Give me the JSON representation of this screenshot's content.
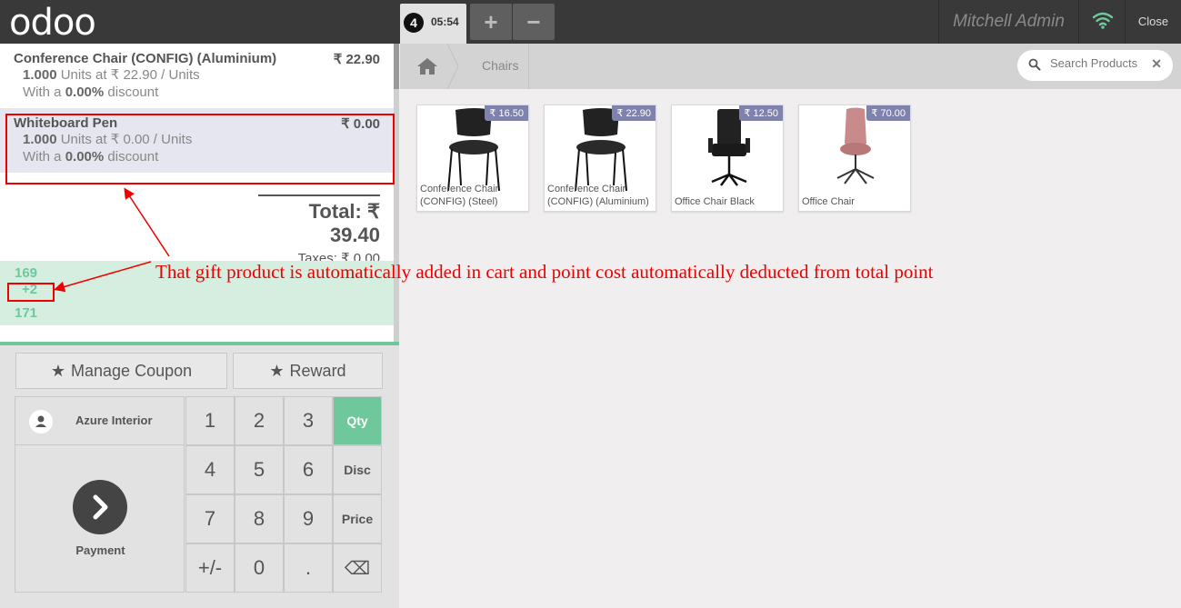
{
  "topbar": {
    "logo": "odoo",
    "order_number": "4",
    "order_time": "05:54",
    "add_order_label": "+",
    "remove_order_label": "−",
    "user_name": "Mitchell Admin",
    "close_label": "Close",
    "wifi_color": "#6ec89b"
  },
  "order": {
    "lines": [
      {
        "name": "Conference Chair (CONFIG) (Aluminium)",
        "price": "₹ 22.90",
        "qty": "1.000",
        "unit_info": "Units at ₹ 22.90 / Units",
        "discount_prefix": "With a",
        "discount": "0.00%",
        "discount_suffix": "discount"
      },
      {
        "name": "Whiteboard Pen",
        "price": "₹ 0.00",
        "qty": "1.000",
        "unit_info": "Units at ₹ 0.00 / Units",
        "discount_prefix": "With a",
        "discount": "0.00%",
        "discount_suffix": "discount",
        "selected": true
      }
    ],
    "total_label": "Total:",
    "total_value": "₹ 39.40",
    "taxes_label": "Taxes:",
    "taxes_value": "₹ 0.00",
    "points": {
      "current": "169",
      "won": "+2",
      "new_total": "171"
    }
  },
  "controls": {
    "manage_coupon": "Manage Coupon",
    "reward": "Reward",
    "customer": "Azure Interior",
    "payment": "Payment"
  },
  "numpad": {
    "keys": [
      "1",
      "2",
      "3",
      "4",
      "5",
      "6",
      "7",
      "8",
      "9",
      "+/-",
      "0",
      "."
    ],
    "modes": [
      "Qty",
      "Disc",
      "Price"
    ],
    "active_mode": "Qty",
    "backspace": "⌫"
  },
  "breadcrumb": {
    "category": "Chairs"
  },
  "search": {
    "placeholder": "Search Products"
  },
  "products": [
    {
      "name": "Conference Chair (CONFIG) (Steel)",
      "price": "₹ 16.50",
      "icon": "black-stacking-chair-image"
    },
    {
      "name": "Conference Chair (CONFIG) (Aluminium)",
      "price": "₹ 22.90",
      "icon": "black-stacking-chair-image"
    },
    {
      "name": "Office Chair Black",
      "price": "₹ 12.50",
      "icon": "black-office-chair-image"
    },
    {
      "name": "Office Chair",
      "price": "₹ 70.00",
      "icon": "pink-swivel-chair-image"
    }
  ],
  "annotation": {
    "text": "That gift product is automatically added in cart and point cost automatically deducted from total point",
    "color": "#ee0000"
  },
  "colors": {
    "accent": "#6ec89b",
    "topbar": "#393939",
    "price_tag": "#7f82ac"
  }
}
